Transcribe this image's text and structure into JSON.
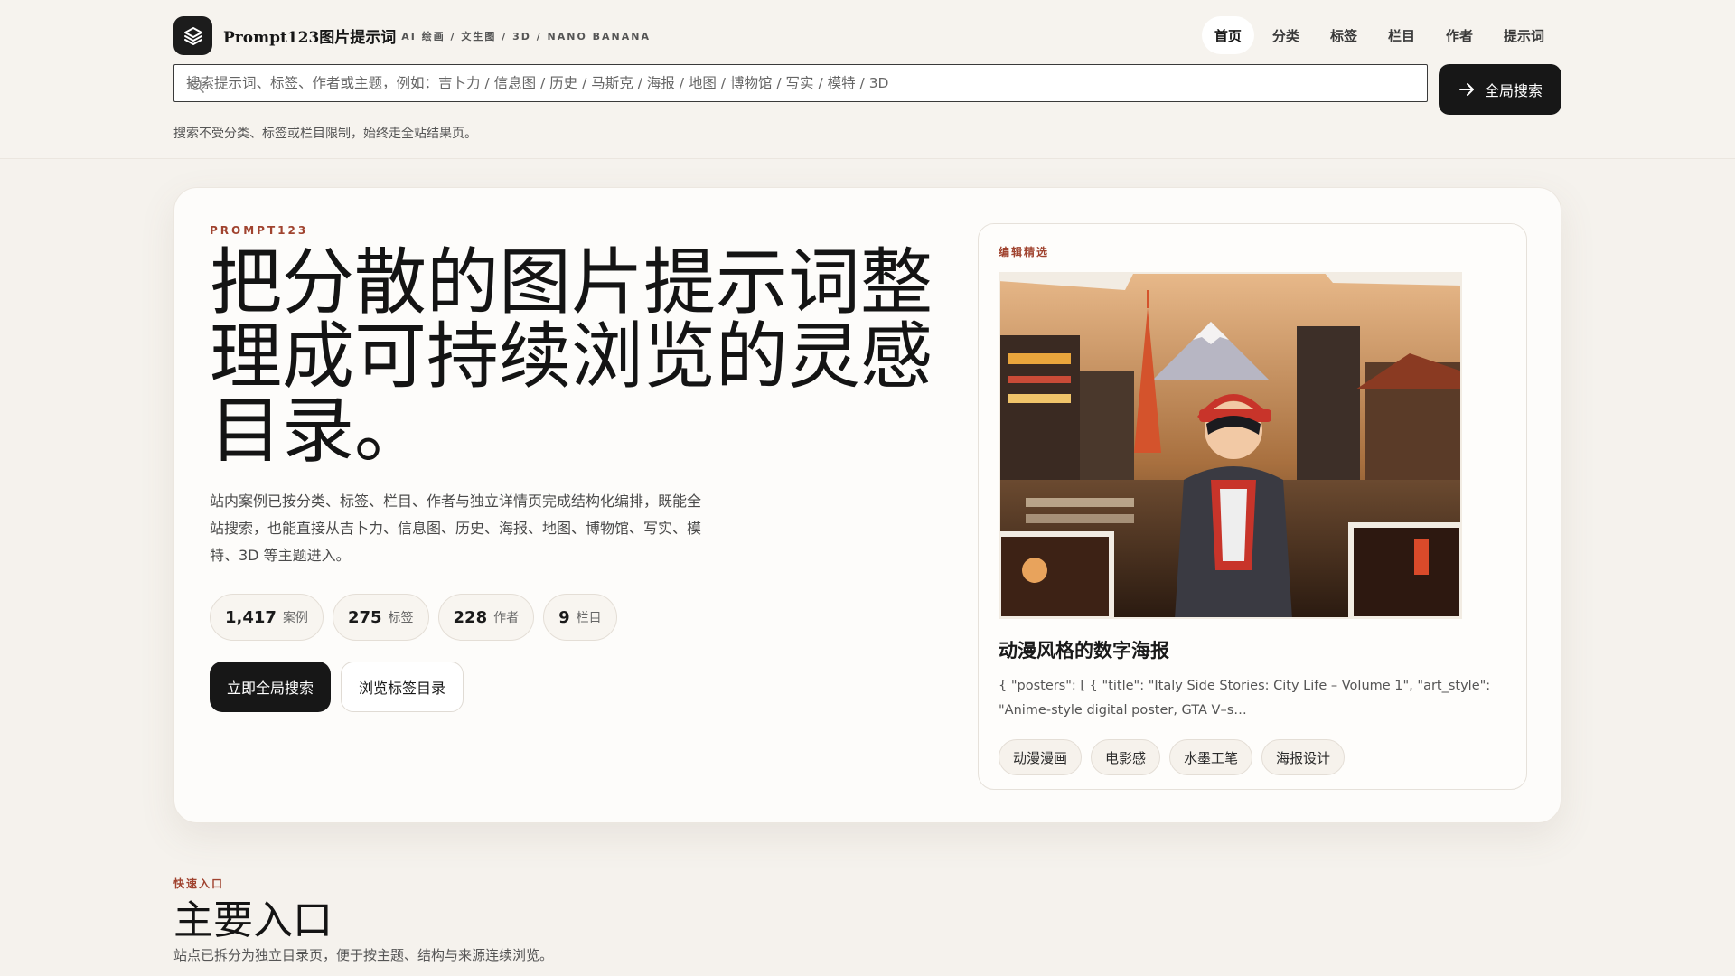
{
  "header": {
    "brand_name": "Prompt123图片提示词",
    "brand_sub": "AI 绘画 / 文生图 / 3D / NANO BANANA",
    "nav": [
      {
        "label": "首页",
        "active": true
      },
      {
        "label": "分类",
        "active": false
      },
      {
        "label": "标签",
        "active": false
      },
      {
        "label": "栏目",
        "active": false
      },
      {
        "label": "作者",
        "active": false
      },
      {
        "label": "提示词",
        "active": false
      }
    ],
    "search_placeholder": "搜索提示词、标签、作者或主题，例如：吉卜力 / 信息图 / 历史 / 马斯克 / 海报 / 地图 / 博物馆 / 写实 / 模特 / 3D",
    "search_button": "全局搜索",
    "search_hint": "搜索不受分类、标签或栏目限制，始终走全站结果页。"
  },
  "hero": {
    "eyebrow": "PROMPT123",
    "title": "把分散的图片提示词整理成可持续浏览的灵感目录。",
    "description": "站内案例已按分类、标签、栏目、作者与独立详情页完成结构化编排，既能全站搜索，也能直接从吉卜力、信息图、历史、海报、地图、博物馆、写实、模特、3D 等主题进入。",
    "stats": [
      {
        "value": "1,417",
        "label": "案例"
      },
      {
        "value": "275",
        "label": "标签"
      },
      {
        "value": "228",
        "label": "作者"
      },
      {
        "value": "9",
        "label": "栏目"
      }
    ],
    "primary_button": "立即全局搜索",
    "secondary_button": "浏览标签目录"
  },
  "featured": {
    "eyebrow": "编辑精选",
    "title": "动漫风格的数字海报",
    "description": "{ \"posters\": [ { \"title\": \"Italy Side Stories: City Life – Volume 1\", \"art_style\": \"Anime-style digital poster, GTA V–s…",
    "tags": [
      "动漫漫画",
      "电影感",
      "水墨工笔",
      "海报设计"
    ]
  },
  "quick": {
    "eyebrow": "快速入口",
    "title": "主要入口",
    "description": "站点已拆分为独立目录页，便于按主题、结构与来源连续浏览。"
  },
  "colors": {
    "accent": "#a0432f",
    "dark": "#171717",
    "background": "#f5f2ed"
  }
}
